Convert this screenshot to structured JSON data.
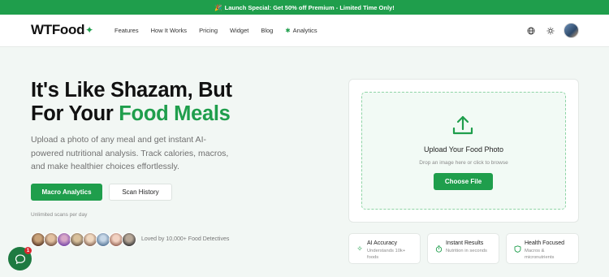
{
  "promo": {
    "emoji": "🎉",
    "text": "Launch Special: Get 50% off Premium - Limited Time Only!"
  },
  "header": {
    "logo": "WTFood",
    "logo_icon": "sparkle-icon",
    "nav": [
      "Features",
      "How It Works",
      "Pricing",
      "Widget",
      "Blog"
    ],
    "analytics_label": "Analytics",
    "icons": [
      "globe-icon",
      "sun-icon",
      "avatar"
    ]
  },
  "hero": {
    "title_line1": "It's Like Shazam, But",
    "title_line2_prefix": "For Your ",
    "title_accent": "Food Meals",
    "subtitle": "Upload a photo of any meal and get instant AI-powered nutritional analysis. Track calories, macros, and make healthier choices effortlessly.",
    "primary_button": "Macro Analytics",
    "secondary_button": "Scan History",
    "scans_note": "Unlimited scans per day",
    "loved_text": "Loved by 10,000+ Food Detectives"
  },
  "upload": {
    "title": "Upload Your Food Photo",
    "hint": "Drop an image here or click to browse",
    "button": "Choose File"
  },
  "features": [
    {
      "title": "AI Accuracy",
      "desc_line1": "Understands 10k+",
      "desc_line2": "foods",
      "icon": "sparkles-icon"
    },
    {
      "title": "Instant Results",
      "desc_line1": "Nutrition in seconds",
      "desc_line2": "",
      "icon": "timer-icon"
    },
    {
      "title": "Health Focused",
      "desc_line1": "Macros &",
      "desc_line2": "micronutrients",
      "icon": "shield-icon"
    }
  ],
  "chat": {
    "badge": "1",
    "icon": "chat-icon"
  },
  "colors": {
    "brand": "#1f9e4c",
    "promo_bg": "#1f9e4c",
    "badge": "#d9282f"
  }
}
